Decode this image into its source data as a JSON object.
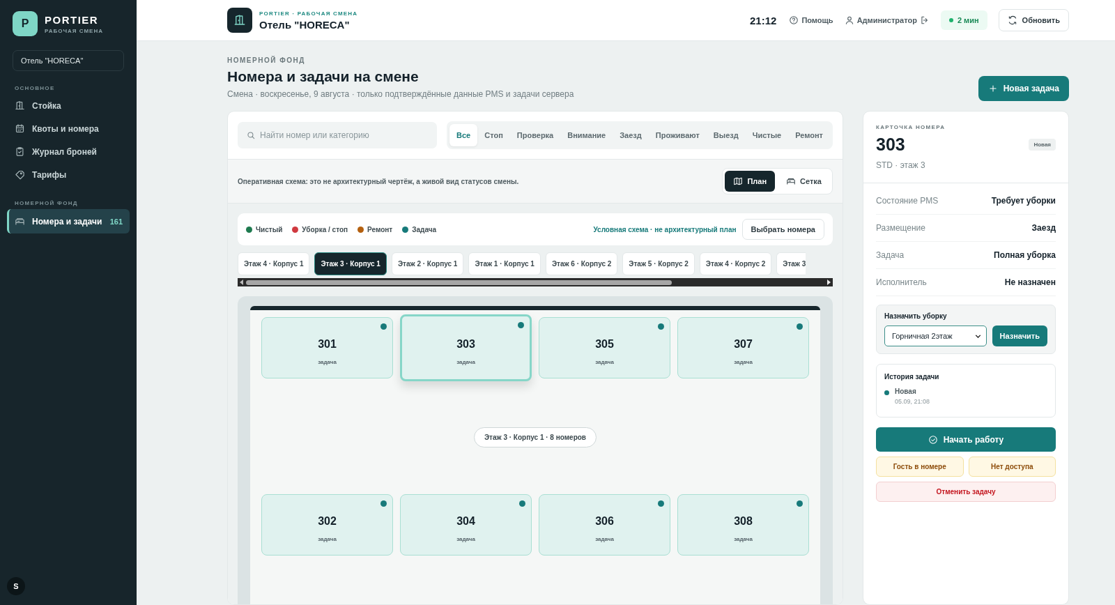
{
  "sidebar": {
    "logo_letter": "P",
    "brand": "PORTIER",
    "subtitle": "РАБОЧАЯ СМЕНА",
    "hotel_select": "Отель \"HORECA\"",
    "sections": [
      {
        "title": "ОСНОВНОЕ",
        "items": [
          {
            "label": "Стойка",
            "selected": false
          },
          {
            "label": "Квоты и номера",
            "selected": false
          },
          {
            "label": "Журнал броней",
            "selected": false
          },
          {
            "label": "Тарифы",
            "selected": false
          }
        ]
      },
      {
        "title": "НОМЕРНОЙ ФОНД",
        "items": [
          {
            "label": "Номера и задачи",
            "count": "161",
            "selected": true
          }
        ]
      }
    ],
    "user_initial": "S"
  },
  "header": {
    "kicker": "PORTIER · РАБОЧАЯ СМЕНА",
    "hotel": "Отель \"HORECA\"",
    "time": "21:12",
    "help": "Помощь",
    "user": "Администратор",
    "sync": "2 мин",
    "refresh": "Обновить"
  },
  "page": {
    "kicker": "НОМЕРНОЙ ФОНД",
    "title": "Номера и задачи на смене",
    "subtitle": "Смена · воскресенье, 9 августа · только подтверждённые данные PMS и задачи сервера",
    "new_task": "Новая задача"
  },
  "search": {
    "placeholder": "Найти номер или категорию"
  },
  "filters": [
    {
      "label": "Все",
      "selected": true
    },
    {
      "label": "Стоп",
      "selected": false
    },
    {
      "label": "Проверка",
      "selected": false
    },
    {
      "label": "Внимание",
      "selected": false
    },
    {
      "label": "Заезд",
      "selected": false
    },
    {
      "label": "Проживают",
      "selected": false
    },
    {
      "label": "Выезд",
      "selected": false
    },
    {
      "label": "Чистые",
      "selected": false
    },
    {
      "label": "Ремонт",
      "selected": false
    }
  ],
  "scheme_note": "Оперативная схема: это не архитектурный чертёж, а живой вид статусов смены.",
  "views": [
    {
      "label": "План",
      "selected": true
    },
    {
      "label": "Сетка",
      "selected": false
    }
  ],
  "legend": [
    {
      "label": "Чистый",
      "color": "#1e7a4f"
    },
    {
      "label": "Уборка / стоп",
      "color": "#d0393f"
    },
    {
      "label": "Ремонт",
      "color": "#b4600f"
    },
    {
      "label": "Задача",
      "color": "#177a7a"
    }
  ],
  "legend_note": "Условная схема · не архитектурный план",
  "pick_rooms": "Выбрать номера",
  "floors": [
    {
      "label": "Этаж 4 · Корпус 1",
      "selected": false
    },
    {
      "label": "Этаж 3 · Корпус 1",
      "selected": true
    },
    {
      "label": "Этаж 2 · Корпус 1",
      "selected": false
    },
    {
      "label": "Этаж 1 · Корпус 1",
      "selected": false
    },
    {
      "label": "Этаж 6 · Корпус 2",
      "selected": false
    },
    {
      "label": "Этаж 5 · Корпус 2",
      "selected": false
    },
    {
      "label": "Этаж 4 · Корпус 2",
      "selected": false
    },
    {
      "label": "Этаж 3",
      "selected": false
    }
  ],
  "floor_plan": {
    "caption": "Этаж 3 · Корпус 1 · 8 номеров",
    "top_rooms": [
      {
        "number": "301",
        "status": "задача",
        "color": "#177a7a",
        "selected": false
      },
      {
        "number": "303",
        "status": "задача",
        "color": "#177a7a",
        "selected": true
      },
      {
        "number": "305",
        "status": "задача",
        "color": "#177a7a",
        "selected": false
      },
      {
        "number": "307",
        "status": "задача",
        "color": "#177a7a",
        "selected": false
      }
    ],
    "bottom_rooms": [
      {
        "number": "302",
        "status": "задача",
        "color": "#177a7a",
        "selected": false
      },
      {
        "number": "304",
        "status": "задача",
        "color": "#177a7a",
        "selected": false
      },
      {
        "number": "306",
        "status": "задача",
        "color": "#177a7a",
        "selected": false
      },
      {
        "number": "308",
        "status": "задача",
        "color": "#177a7a",
        "selected": false
      }
    ]
  },
  "room_card": {
    "kicker": "КАРТОЧКА НОМЕРА",
    "number": "303",
    "badge": "Новая",
    "meta": "STD · этаж 3",
    "fields": [
      {
        "label": "Состояние PMS",
        "value": "Требует уборки"
      },
      {
        "label": "Размещение",
        "value": "Заезд"
      },
      {
        "label": "Задача",
        "value": "Полная уборка"
      },
      {
        "label": "Исполнитель",
        "value": "Не назначен"
      }
    ],
    "assign": {
      "title": "Назначить уборку",
      "selected_option": "Горничная 2этаж",
      "button": "Назначить"
    },
    "history": {
      "title": "История задачи",
      "entries": [
        {
          "status": "Новая",
          "time": "05.09, 21:08",
          "color": "#177a7a"
        }
      ]
    },
    "actions": [
      {
        "label": "Начать работу",
        "kind": "primary"
      },
      {
        "label": "Гость в номере",
        "kind": "warning"
      },
      {
        "label": "Нет доступа",
        "kind": "warning"
      },
      {
        "label": "Отменить задачу",
        "kind": "danger"
      }
    ]
  }
}
